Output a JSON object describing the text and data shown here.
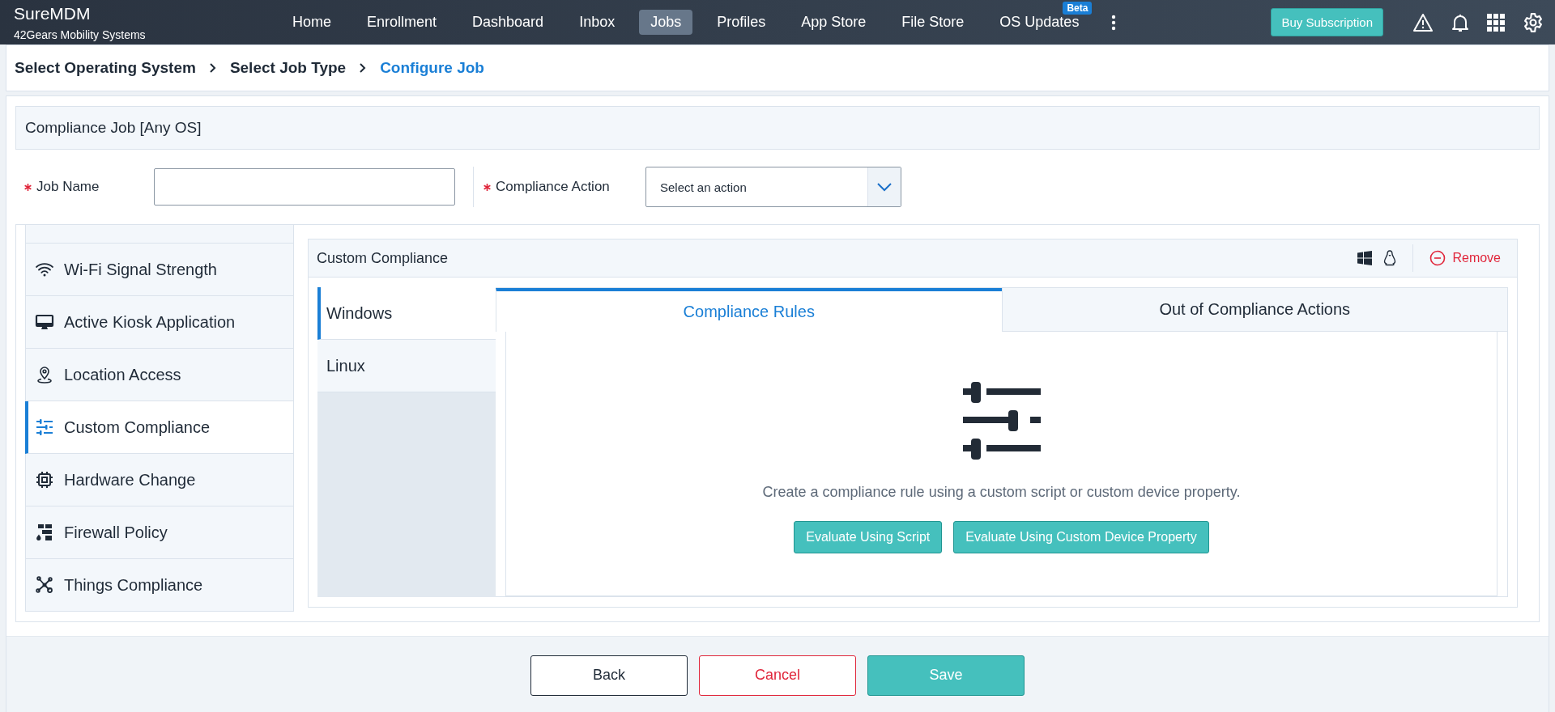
{
  "app": {
    "name": "SureMDM",
    "company": "42Gears Mobility Systems"
  },
  "nav": [
    {
      "label": "Home",
      "selected": false
    },
    {
      "label": "Enrollment",
      "selected": false
    },
    {
      "label": "Dashboard",
      "selected": false
    },
    {
      "label": "Inbox",
      "selected": false
    },
    {
      "label": "Jobs",
      "selected": true
    },
    {
      "label": "Profiles",
      "selected": false
    },
    {
      "label": "App Store",
      "selected": false
    },
    {
      "label": "File Store",
      "selected": false
    },
    {
      "label": "OS Updates",
      "selected": false,
      "badge": "Beta"
    }
  ],
  "buy_button": "Buy Subscription",
  "breadcrumb": [
    {
      "label": "Select Operating System",
      "selected": false
    },
    {
      "label": "Select Job Type",
      "selected": false
    },
    {
      "label": "Configure Job",
      "selected": true
    }
  ],
  "job_title": "Compliance Job [Any OS]",
  "form": {
    "job_name": {
      "label": "Job Name",
      "required": true
    },
    "compliance_action": {
      "label": "Compliance Action",
      "required": true,
      "placeholder": "Select an action"
    }
  },
  "rules": [
    {
      "label": "Wi-Fi Signal Strength",
      "kind": "wifi",
      "selected": false
    },
    {
      "label": "Active Kiosk Application",
      "kind": "monitor",
      "selected": false
    },
    {
      "label": "Location Access",
      "kind": "pin",
      "selected": false
    },
    {
      "label": "Custom Compliance",
      "kind": "sliders",
      "selected": true
    },
    {
      "label": "Hardware Change",
      "kind": "chip",
      "selected": false
    },
    {
      "label": "Firewall Policy",
      "kind": "firewall",
      "selected": false
    },
    {
      "label": "Things Compliance",
      "kind": "network",
      "selected": false
    }
  ],
  "panel": {
    "title": "Custom Compliance",
    "remove": "Remove",
    "os_tabs": [
      {
        "label": "Windows",
        "selected": true
      },
      {
        "label": "Linux",
        "selected": false
      }
    ],
    "tabs": [
      {
        "label": "Compliance Rules",
        "selected": true
      },
      {
        "label": "Out of Compliance Actions",
        "selected": false
      }
    ],
    "empty_text": "Create a compliance rule using a custom script or custom device property.",
    "actions": [
      "Evaluate Using Script",
      "Evaluate Using Custom Device Property"
    ]
  },
  "footer": [
    {
      "label": "Back",
      "kind": "default"
    },
    {
      "label": "Cancel",
      "kind": "danger"
    },
    {
      "label": "Save",
      "kind": "primary"
    }
  ]
}
